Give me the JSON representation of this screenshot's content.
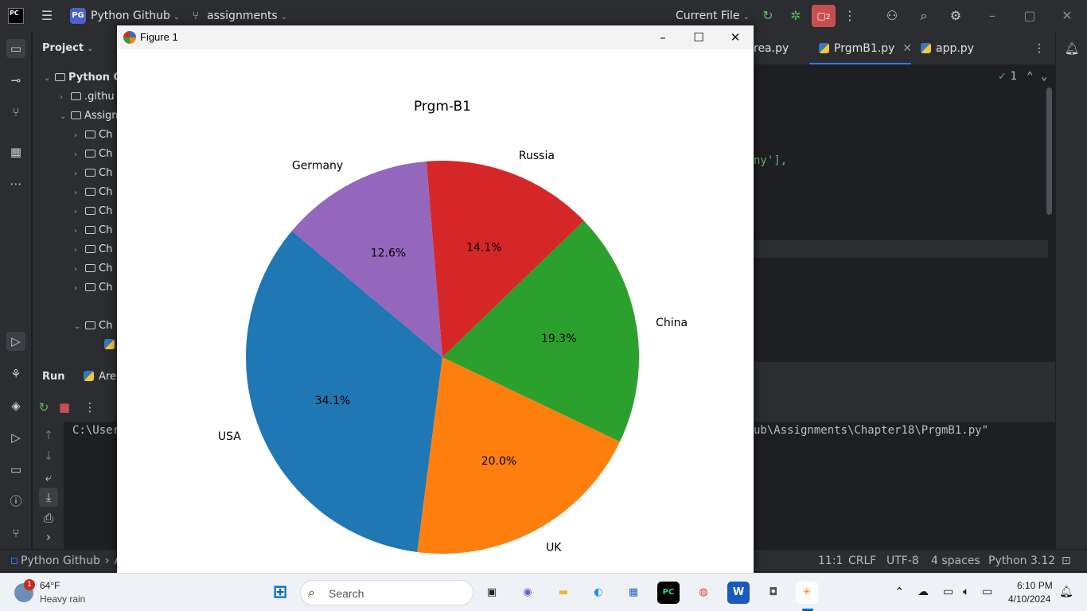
{
  "ide": {
    "logo": "PC",
    "project_badge": "PG",
    "project_name": "Python Github",
    "branch": "assignments",
    "run_config": "Current File",
    "run_widget_count": "2",
    "panel_title": "Project",
    "tree": {
      "root": "Python G",
      "items": [
        ".githu",
        "Assign",
        "Ch",
        "Ch",
        "Ch",
        "Ch",
        "Ch",
        "Ch",
        "Ch",
        "Ch",
        "Ch",
        "Ch"
      ]
    },
    "run_tab": "Run",
    "run_config_tab": "Are",
    "console_left": "C:\\User",
    "tabs": [
      {
        "label": "rea.py",
        "active": false
      },
      {
        "label": "PrgmB1.py",
        "active": true
      },
      {
        "label": "app.py",
        "active": false
      }
    ],
    "inspection_count": "1",
    "code_fragment": "ny'],",
    "console_right": "ub\\Assignments\\Chapter18\\PrgmB1.py\"",
    "status": {
      "breadcrumb_root": "Python Github",
      "breadcrumb_next": "A",
      "position": "11:1",
      "line_sep": "CRLF",
      "encoding": "UTF-8",
      "indent": "4 spaces",
      "interpreter": "Python 3.12"
    }
  },
  "figure": {
    "window_title": "Figure 1"
  },
  "chart_data": {
    "type": "pie",
    "title": "Prgm-B1",
    "labels": [
      "USA",
      "UK",
      "China",
      "Russia",
      "Germany"
    ],
    "percentages": [
      34.1,
      20.0,
      19.3,
      14.1,
      12.6
    ],
    "autopct_labels": [
      "34.1%",
      "20.0%",
      "19.3%",
      "14.1%",
      "12.6%"
    ],
    "start_angle_deg": 140,
    "direction": "counterclockwise",
    "colors": [
      "#1f77b4",
      "#ff7f0e",
      "#2ca02c",
      "#d62728",
      "#9467bd"
    ]
  },
  "taskbar": {
    "weather_temp": "64°F",
    "weather_desc": "Heavy rain",
    "weather_badge": "1",
    "search_placeholder": "Search",
    "time": "6:10 PM",
    "date": "4/10/2024"
  }
}
